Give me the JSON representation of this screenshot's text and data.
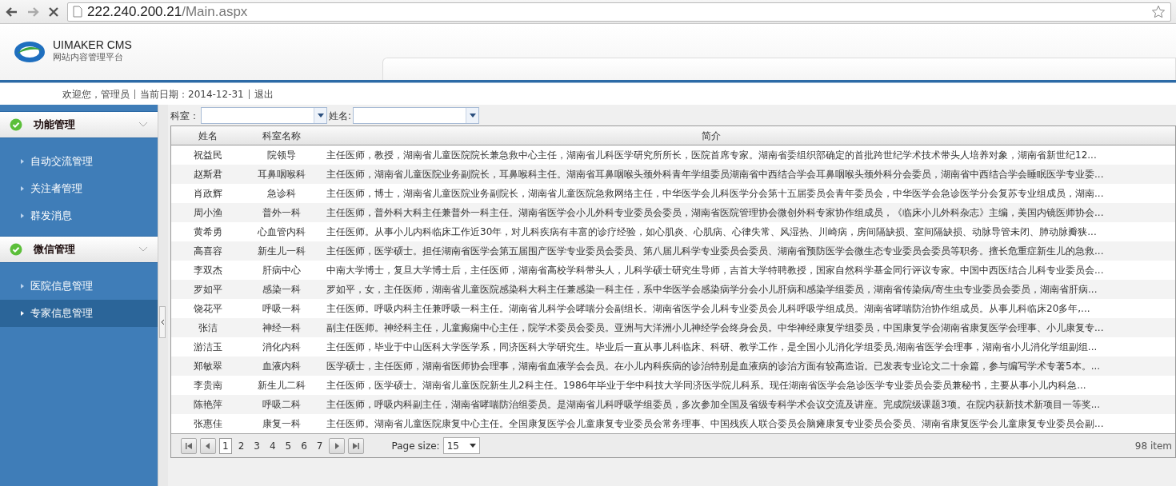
{
  "browser": {
    "url_host": "222.240.200.21",
    "url_path": "/Main.aspx"
  },
  "header": {
    "brand": "UIMAKER CMS",
    "subtitle": "网站内容管理平台"
  },
  "welcome": {
    "greeting": "欢迎您，管理员",
    "date_label": "当前日期：",
    "date": "2014-12-31",
    "logout": "退出"
  },
  "sidebar": {
    "groups": [
      {
        "title": "功能管理",
        "expanded": true,
        "items": [
          {
            "label": "自动交流管理",
            "selected": false
          },
          {
            "label": "关注者管理",
            "selected": false
          },
          {
            "label": "群发消息",
            "selected": false
          }
        ]
      },
      {
        "title": "微信管理",
        "expanded": true,
        "items": [
          {
            "label": "医院信息管理",
            "selected": false
          },
          {
            "label": "专家信息管理",
            "selected": true
          }
        ]
      }
    ]
  },
  "filters": [
    {
      "label": "科室："
    },
    {
      "label": "姓名:"
    }
  ],
  "table": {
    "columns": [
      "姓名",
      "科室名称",
      "简介"
    ],
    "rows": [
      [
        "祝益民",
        "院领导",
        "主任医师，教授，湖南省儿童医院院长兼急救中心主任，湖南省儿科医学研究所所长，医院首席专家。湖南省委组织部确定的首批跨世纪学术技术带头人培养对象，湖南省新世纪12..."
      ],
      [
        "赵斯君",
        "耳鼻咽喉科",
        "主任医师，湖南省儿童医院业务副院长，耳鼻喉科主任。湖南省耳鼻咽喉头颈外科青年学组委员湖南省中西结合学会耳鼻咽喉头颈外科分会委员，湖南省中西结合学会睡眠医学专业委..."
      ],
      [
        "肖政辉",
        "急诊科",
        "主任医师，博士，湖南省儿童医院业务副院长，湖南省儿童医院急救网络主任，中华医学会儿科医学分会第十五届委员会青年委员会，中华医学会急诊医学分会复苏专业组成员，湖南..."
      ],
      [
        "周小渔",
        "普外一科",
        "主任医师，普外科大科主任兼普外一科主任。湖南省医学会小儿外科专业委员会委员，湖南省医院管理协会微创外科专家协作组成员，《临床小儿外科杂志》主编，美国内镜医师协会..."
      ],
      [
        "黄希勇",
        "心血管内科",
        "主任医师。从事小儿内科临床工作近30年，对儿科疾病有丰富的诊疗经验，如心肌炎、心肌病、心律失常、风湿热、川崎病，房间隔缺损、室间隔缺损、动脉导管未闭、肺动脉瓣狭..."
      ],
      [
        "高喜容",
        "新生儿一科",
        "主任医师，医学硕士。担任湖南省医学会第五届围产医学专业委员会委员、第八届儿科学专业委员会委员、湖南省预防医学会微生态专业委员会委员等职务。擅长危重症新生儿的急救..."
      ],
      [
        "李双杰",
        "肝病中心",
        "中南大学博士，复旦大学博士后，主任医师，湖南省高校学科带头人，儿科学硕士研究生导师，吉首大学特聘教授，国家自然科学基金同行评议专家。中国中西医结合儿科专业委员会..."
      ],
      [
        "罗如平",
        "感染一科",
        "罗如平，女，主任医师，湖南省儿童医院感染科大科主任兼感染一科主任，系中华医学会感染病学分会小儿肝病和感染学组委员，湖南省传染病/寄生虫专业委员会委员，湖南省肝病..."
      ],
      [
        "饶花平",
        "呼吸一科",
        "主任医师。呼吸内科主任兼呼吸一科主任。湖南省儿科学会哮喘分会副组长。湖南省医学会儿科专业委员会儿科呼吸学组成员。湖南省哮喘防治协作组成员。从事儿科临床20多年,..."
      ],
      [
        "张洁",
        "神经一科",
        "副主任医师。神经科主任，儿童癫痫中心主任，院学术委员会委员。亚洲与大洋洲小儿神经学会终身会员。中华神经康复学组委员，中国康复学会湖南省康复医学会理事、小儿康复专..."
      ],
      [
        "游洁玉",
        "消化内科",
        "主任医师，毕业于中山医科大学医学系，同济医科大学研究生。毕业后一直从事儿科临床、科研、教学工作，是全国小儿消化学组委员,湖南省医学会理事，湖南省小儿消化学组副组..."
      ],
      [
        "郑敏翠",
        "血液内科",
        "医学硕士，主任医师，湖南省医师协会理事，湖南省血液学会会员。在小儿内科疾病的诊治特别是血液病的诊治方面有较高造诣。已发表专业论文二十余篇，参与编写学术专著5本。..."
      ],
      [
        "李贵南",
        "新生儿二科",
        "主任医师，医学硕士。湖南省儿童医院新生儿2科主任。1986年毕业于华中科技大学同济医学院儿科系。现任湖南省医学会急诊医学专业委员会委员兼秘书，主要从事小儿内科急..."
      ],
      [
        "陈艳萍",
        "呼吸二科",
        "主任医师，呼吸内科副主任，湖南省哮喘防治组委员。是湖南省儿科呼吸学组委员，多次参加全国及省级专科学术会议交流及讲座。完成院级课题3项。在院内获新技术新项目一等奖..."
      ],
      [
        "张惠佳",
        "康复一科",
        "主任医师。湖南省儿童医院康复中心主任。全国康复医学会儿童康复专业委员会常务理事、中国残疾人联合委员会脑瘫康复专业委员会委员、湖南省康复医学会儿童康复专业委员会副..."
      ]
    ]
  },
  "pager": {
    "pages": [
      {
        "label": "1",
        "selected": true
      },
      {
        "label": "2",
        "selected": false
      },
      {
        "label": "3",
        "selected": false
      },
      {
        "label": "4",
        "selected": false
      },
      {
        "label": "5",
        "selected": false
      },
      {
        "label": "6",
        "selected": false
      },
      {
        "label": "7",
        "selected": false
      }
    ],
    "page_size_label": "Page size:",
    "page_size": "15",
    "item_count": "98 item"
  }
}
